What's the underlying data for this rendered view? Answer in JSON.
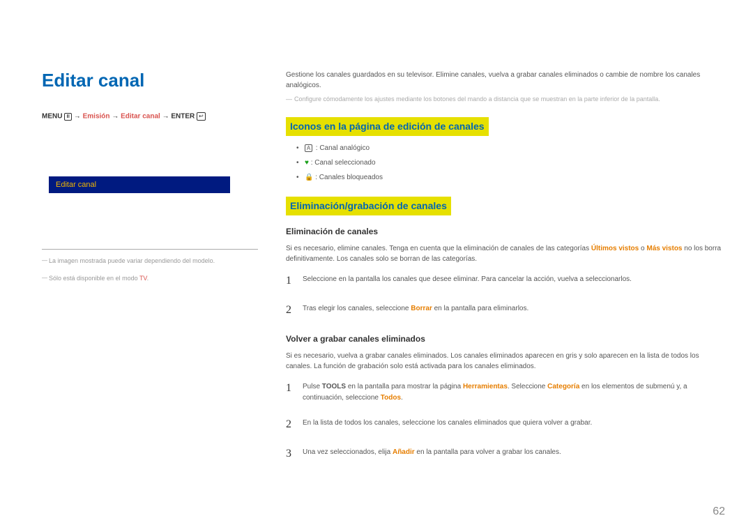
{
  "title": "Editar canal",
  "breadcrumb": {
    "menu": "MENU",
    "arrow": "→",
    "emision": "Emisión",
    "editar": "Editar canal",
    "enter": "ENTER"
  },
  "panel_label": "Editar canal",
  "footnote1": "La imagen mostrada puede variar dependiendo del modelo.",
  "footnote2_pre": "Sólo está disponible en el modo ",
  "footnote2_tv": "TV",
  "intro": "Gestione los canales guardados en su televisor. Elimine canales, vuelva a grabar canales eliminados o cambie de nombre los canales analógicos.",
  "config_note": "Configure cómodamente los ajustes mediante los botones del mando a distancia que se muestran en la parte inferior de la pantalla.",
  "section1": "Iconos en la página de edición de canales",
  "icons": {
    "a_label": " : Canal analógico",
    "heart_label": " : Canal seleccionado",
    "lock_label": " : Canales bloqueados"
  },
  "section2": "Eliminación/grabación de canales",
  "sub1": "Eliminación de canales",
  "sub1_text_pre": "Si es necesario, elimine canales. Tenga en cuenta que la eliminación de canales de las categorías ",
  "ultimos": "Últimos vistos",
  "o_text": " o ",
  "mas_vistos": "Más vistos",
  "sub1_text_post": " no los borra definitivamente. Los canales solo se borran de las categorías.",
  "step1_1": "Seleccione en la pantalla los canales que desee eliminar. Para cancelar la acción, vuelva a seleccionarlos.",
  "step1_2_pre": "Tras elegir los canales, seleccione ",
  "borrar": "Borrar",
  "step1_2_post": " en la pantalla para eliminarlos.",
  "sub2": "Volver a grabar canales eliminados",
  "sub2_text": "Si es necesario, vuelva a grabar canales eliminados. Los canales eliminados aparecen en gris y solo aparecen en la lista de todos los canales. La función de grabación solo está activada para los canales eliminados.",
  "step2_1_pre": "Pulse ",
  "tools": "TOOLS",
  "step2_1_mid": " en la pantalla para mostrar la página ",
  "herramientas": "Herramientas",
  "step2_1_mid2": ". Seleccione ",
  "categoria": "Categoría",
  "step2_1_mid3": " en los elementos de submenú y, a continuación, seleccione ",
  "todos": "Todos",
  "step2_2": "En la lista de todos los canales, seleccione los canales eliminados que quiera volver a grabar.",
  "step2_3_pre": "Una vez seleccionados, elija ",
  "anadir": "Añadir",
  "step2_3_post": " en la pantalla para volver a grabar los canales.",
  "page_num": "62"
}
